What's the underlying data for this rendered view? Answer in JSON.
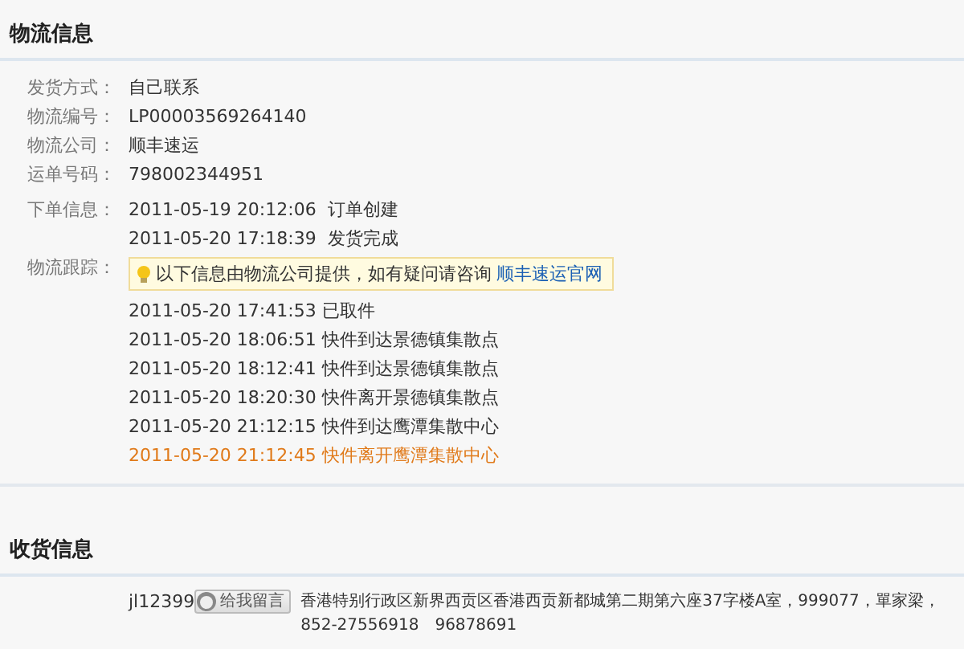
{
  "logistics": {
    "title": "物流信息",
    "fields": [
      {
        "label": "发货方式：",
        "value": "自己联系"
      },
      {
        "label": "物流编号：",
        "value": "LP00003569264140"
      },
      {
        "label": "物流公司：",
        "value": "顺丰速运"
      },
      {
        "label": "运单号码：",
        "value": "798002344951"
      }
    ],
    "order_info": {
      "label": "下单信息：",
      "entries": [
        {
          "time": "2011-05-19 20:12:06",
          "status": "订单创建"
        },
        {
          "time": "2011-05-20 17:18:39",
          "status": "发货完成"
        }
      ]
    },
    "tracking": {
      "label": "物流跟踪：",
      "notice": "以下信息由物流公司提供，如有疑问请咨询",
      "notice_link": "顺丰速运官网",
      "events": [
        {
          "time": "2011-05-20 17:41:53",
          "status": "已取件",
          "latest": false
        },
        {
          "time": "2011-05-20 18:06:51",
          "status": "快件到达景德镇集散点",
          "latest": false
        },
        {
          "time": "2011-05-20 18:12:41",
          "status": "快件到达景德镇集散点",
          "latest": false
        },
        {
          "time": "2011-05-20 18:20:30",
          "status": "快件离开景德镇集散点",
          "latest": false
        },
        {
          "time": "2011-05-20 21:12:15",
          "status": "快件到达鹰潭集散中心",
          "latest": false
        },
        {
          "time": "2011-05-20 21:12:45",
          "status": "快件离开鹰潭集散中心",
          "latest": true
        }
      ]
    }
  },
  "receiving": {
    "title": "收货信息",
    "user": "jl12399",
    "message_button": "给我留言",
    "address": "香港特别行政区新界西贡区香港西贡新都城第二期第六座37字楼A室，999077，單家梁，852-27556918　96878691"
  }
}
